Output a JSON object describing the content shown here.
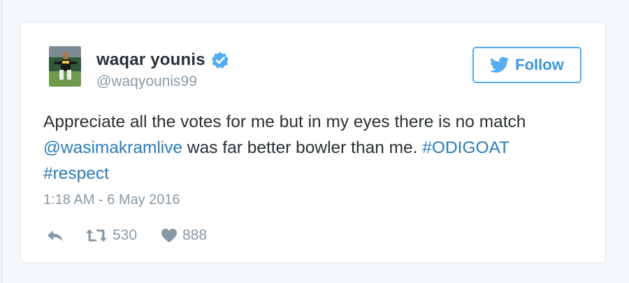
{
  "tweet": {
    "author": {
      "display_name": "waqar younis",
      "handle": "@waqyounis99",
      "verified": true,
      "avatar_icon": "avatar-photo"
    },
    "follow_button": {
      "label": "Follow",
      "icon": "twitter-bird-icon",
      "accent_color": "#55acee"
    },
    "text": {
      "line1": "Appreciate all the votes for me but in my eyes there is no match",
      "mention": "@wasimakramlive",
      "middle": " was far better bowler than me. ",
      "hashtag1": "#ODIGOAT",
      "hashtag2": "#respect"
    },
    "timestamp": "1:18 AM - 6 May 2016",
    "actions": {
      "reply_icon": "reply-icon",
      "retweet_icon": "retweet-icon",
      "retweet_count": "530",
      "like_icon": "heart-icon",
      "like_count": "888"
    },
    "colors": {
      "link": "#2b7bb9",
      "muted": "#8899a6",
      "verified": "#55acee"
    }
  }
}
